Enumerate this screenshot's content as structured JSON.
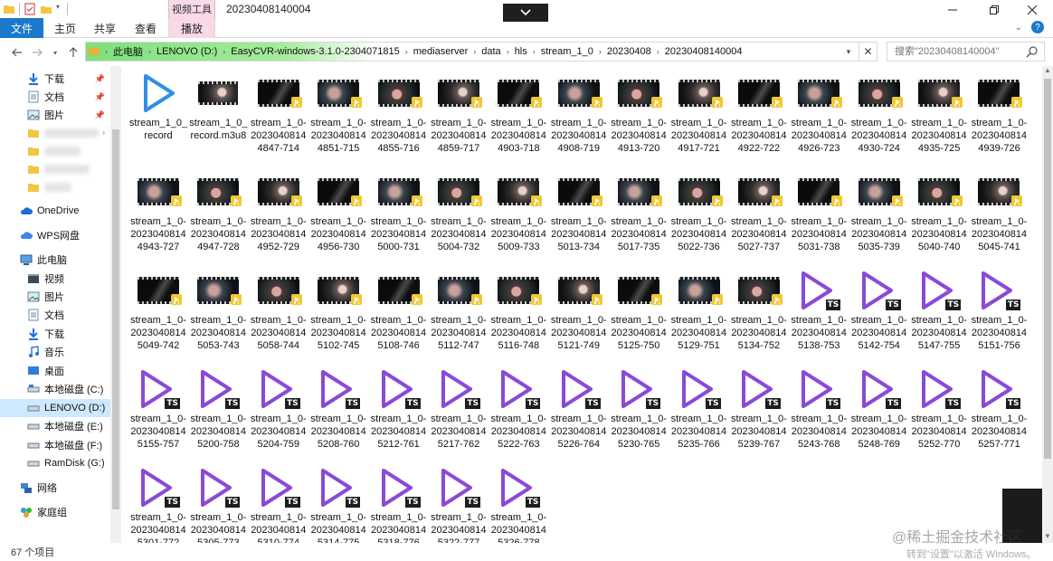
{
  "titlebar": {
    "context_tab_title": "视频工具",
    "window_title": "20230408140004"
  },
  "ribbon": {
    "file": "文件",
    "home": "主页",
    "share": "共享",
    "view": "查看",
    "play": "播放"
  },
  "address": {
    "crumbs": [
      "此电脑",
      "LENOVO (D:)",
      "EasyCVR-windows-3.1.0-2304071815",
      "mediaserver",
      "data",
      "hls",
      "stream_1_0",
      "20230408",
      "20230408140004"
    ],
    "search_placeholder": "搜索\"20230408140004\""
  },
  "sidebar": {
    "items": [
      {
        "label": "下载",
        "icon": "download-icon",
        "pinned": true
      },
      {
        "label": "文档",
        "icon": "document-icon",
        "pinned": true
      },
      {
        "label": "图片",
        "icon": "picture-icon",
        "pinned": true
      },
      {
        "label": "",
        "icon": "folder-icon",
        "pinned": false
      },
      {
        "label": "",
        "icon": "folder-icon",
        "pinned": false
      },
      {
        "label": "",
        "icon": "folder-icon",
        "pinned": false
      },
      {
        "label": "",
        "icon": "folder-icon",
        "pinned": false
      },
      {
        "label": "OneDrive",
        "icon": "cloud-icon",
        "pinned": false
      },
      {
        "label": "WPS网盘",
        "icon": "wps-cloud-icon",
        "pinned": false
      },
      {
        "label": "此电脑",
        "icon": "computer-icon",
        "pinned": false
      },
      {
        "label": "视频",
        "icon": "video-folder-icon",
        "pinned": false
      },
      {
        "label": "图片",
        "icon": "picture-icon",
        "pinned": false
      },
      {
        "label": "文档",
        "icon": "document-icon",
        "pinned": false
      },
      {
        "label": "下载",
        "icon": "download-icon",
        "pinned": false
      },
      {
        "label": "音乐",
        "icon": "music-icon",
        "pinned": false
      },
      {
        "label": "桌面",
        "icon": "desktop-icon",
        "pinned": false
      },
      {
        "label": "本地磁盘 (C:)",
        "icon": "drive-icon",
        "pinned": false
      },
      {
        "label": "LENOVO (D:)",
        "icon": "drive-icon",
        "pinned": false,
        "selected": true
      },
      {
        "label": "本地磁盘 (E:)",
        "icon": "drive-icon",
        "pinned": false
      },
      {
        "label": "本地磁盘 (F:)",
        "icon": "drive-icon",
        "pinned": false
      },
      {
        "label": "RamDisk (G:)",
        "icon": "drive-icon",
        "pinned": false
      },
      {
        "label": "网络",
        "icon": "network-icon",
        "pinned": false
      },
      {
        "label": "家庭组",
        "icon": "homegroup-icon",
        "pinned": false
      }
    ]
  },
  "files": [
    {
      "name": "stream_1_0_record",
      "type": "play"
    },
    {
      "name": "stream_1_0_record.m3u8",
      "type": "m3u8"
    },
    {
      "name": "stream_1_0-20230408144847-714",
      "type": "video"
    },
    {
      "name": "stream_1_0-20230408144851-715",
      "type": "video"
    },
    {
      "name": "stream_1_0-20230408144855-716",
      "type": "video"
    },
    {
      "name": "stream_1_0-20230408144859-717",
      "type": "video"
    },
    {
      "name": "stream_1_0-20230408144903-718",
      "type": "video"
    },
    {
      "name": "stream_1_0-20230408144908-719",
      "type": "video"
    },
    {
      "name": "stream_1_0-20230408144913-720",
      "type": "video"
    },
    {
      "name": "stream_1_0-20230408144917-721",
      "type": "video"
    },
    {
      "name": "stream_1_0-20230408144922-722",
      "type": "video"
    },
    {
      "name": "stream_1_0-20230408144926-723",
      "type": "video"
    },
    {
      "name": "stream_1_0-20230408144930-724",
      "type": "video"
    },
    {
      "name": "stream_1_0-20230408144935-725",
      "type": "video"
    },
    {
      "name": "stream_1_0-20230408144939-726",
      "type": "video"
    },
    {
      "name": "stream_1_0-20230408144943-727",
      "type": "video"
    },
    {
      "name": "stream_1_0-20230408144947-728",
      "type": "video"
    },
    {
      "name": "stream_1_0-20230408144952-729",
      "type": "video"
    },
    {
      "name": "stream_1_0-20230408144956-730",
      "type": "video"
    },
    {
      "name": "stream_1_0-20230408145000-731",
      "type": "video"
    },
    {
      "name": "stream_1_0-20230408145004-732",
      "type": "video"
    },
    {
      "name": "stream_1_0-20230408145009-733",
      "type": "video"
    },
    {
      "name": "stream_1_0-20230408145013-734",
      "type": "video"
    },
    {
      "name": "stream_1_0-20230408145017-735",
      "type": "video"
    },
    {
      "name": "stream_1_0-20230408145022-736",
      "type": "video"
    },
    {
      "name": "stream_1_0-20230408145027-737",
      "type": "video"
    },
    {
      "name": "stream_1_0-20230408145031-738",
      "type": "video"
    },
    {
      "name": "stream_1_0-20230408145035-739",
      "type": "video"
    },
    {
      "name": "stream_1_0-20230408145040-740",
      "type": "video"
    },
    {
      "name": "stream_1_0-20230408145045-741",
      "type": "video"
    },
    {
      "name": "stream_1_0-20230408145049-742",
      "type": "video"
    },
    {
      "name": "stream_1_0-20230408145053-743",
      "type": "video"
    },
    {
      "name": "stream_1_0-20230408145058-744",
      "type": "video"
    },
    {
      "name": "stream_1_0-20230408145102-745",
      "type": "video"
    },
    {
      "name": "stream_1_0-20230408145108-746",
      "type": "video"
    },
    {
      "name": "stream_1_0-20230408145112-747",
      "type": "video"
    },
    {
      "name": "stream_1_0-20230408145116-748",
      "type": "video"
    },
    {
      "name": "stream_1_0-20230408145121-749",
      "type": "video"
    },
    {
      "name": "stream_1_0-20230408145125-750",
      "type": "video"
    },
    {
      "name": "stream_1_0-20230408145129-751",
      "type": "video"
    },
    {
      "name": "stream_1_0-20230408145134-752",
      "type": "video"
    },
    {
      "name": "stream_1_0-20230408145138-753",
      "type": "ts"
    },
    {
      "name": "stream_1_0-20230408145142-754",
      "type": "ts"
    },
    {
      "name": "stream_1_0-20230408145147-755",
      "type": "ts"
    },
    {
      "name": "stream_1_0-20230408145151-756",
      "type": "ts"
    },
    {
      "name": "stream_1_0-20230408145155-757",
      "type": "ts"
    },
    {
      "name": "stream_1_0-20230408145200-758",
      "type": "ts"
    },
    {
      "name": "stream_1_0-20230408145204-759",
      "type": "ts"
    },
    {
      "name": "stream_1_0-20230408145208-760",
      "type": "ts"
    },
    {
      "name": "stream_1_0-20230408145212-761",
      "type": "ts"
    },
    {
      "name": "stream_1_0-20230408145217-762",
      "type": "ts"
    },
    {
      "name": "stream_1_0-20230408145222-763",
      "type": "ts"
    },
    {
      "name": "stream_1_0-20230408145226-764",
      "type": "ts"
    },
    {
      "name": "stream_1_0-20230408145230-765",
      "type": "ts"
    },
    {
      "name": "stream_1_0-20230408145235-766",
      "type": "ts"
    },
    {
      "name": "stream_1_0-20230408145239-767",
      "type": "ts"
    },
    {
      "name": "stream_1_0-20230408145243-768",
      "type": "ts"
    },
    {
      "name": "stream_1_0-20230408145248-769",
      "type": "ts"
    },
    {
      "name": "stream_1_0-20230408145252-770",
      "type": "ts"
    },
    {
      "name": "stream_1_0-20230408145257-771",
      "type": "ts"
    },
    {
      "name": "stream_1_0-20230408145301-772",
      "type": "ts"
    },
    {
      "name": "stream_1_0-20230408145305-773",
      "type": "ts"
    },
    {
      "name": "stream_1_0-20230408145310-774",
      "type": "ts"
    },
    {
      "name": "stream_1_0-20230408145314-775",
      "type": "ts"
    },
    {
      "name": "stream_1_0-20230408145318-776",
      "type": "ts"
    },
    {
      "name": "stream_1_0-20230408145322-777",
      "type": "ts"
    },
    {
      "name": "stream_1_0-20230408145326-778",
      "type": "ts"
    }
  ],
  "ts_badge": "TS",
  "status": {
    "item_count": "67 个项目"
  },
  "watermark": {
    "line1": "@稀土掘金技术社区",
    "line2": "转到\"设置\"以激活 Windows。"
  },
  "colors": {
    "file_tab": "#1979ca",
    "context_tab": "#f7d9e7",
    "selected_nav": "#cde8ff",
    "play_icon_blue": "#2f8fe8",
    "ts_icon_purple": "#8a4ad6",
    "video_badge": "#f2c832"
  }
}
